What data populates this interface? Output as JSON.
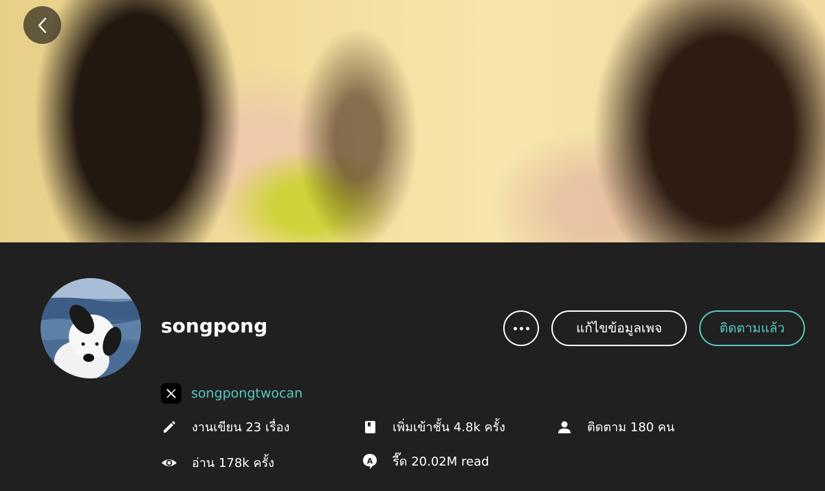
{
  "header": {
    "back_icon": "chevron-left-icon"
  },
  "profile": {
    "username": "songpong",
    "x_handle": "songpongtwocan"
  },
  "actions": {
    "more_icon": "more-horizontal-icon",
    "edit_label": "แก้ไขข้อมูลเพจ",
    "follow_label": "ติดตามแล้ว"
  },
  "stats": {
    "works": "งานเขียน 23 เรื่อง",
    "library": "เพิ่มเข้าชั้น 4.8k ครั้ง",
    "followers": "ติดตาม 180 คน",
    "views": "อ่าน 178k ครั้ง",
    "reads": "รี๊ด 20.02M read"
  },
  "colors": {
    "accent": "#57c7c0",
    "background": "#202020"
  }
}
